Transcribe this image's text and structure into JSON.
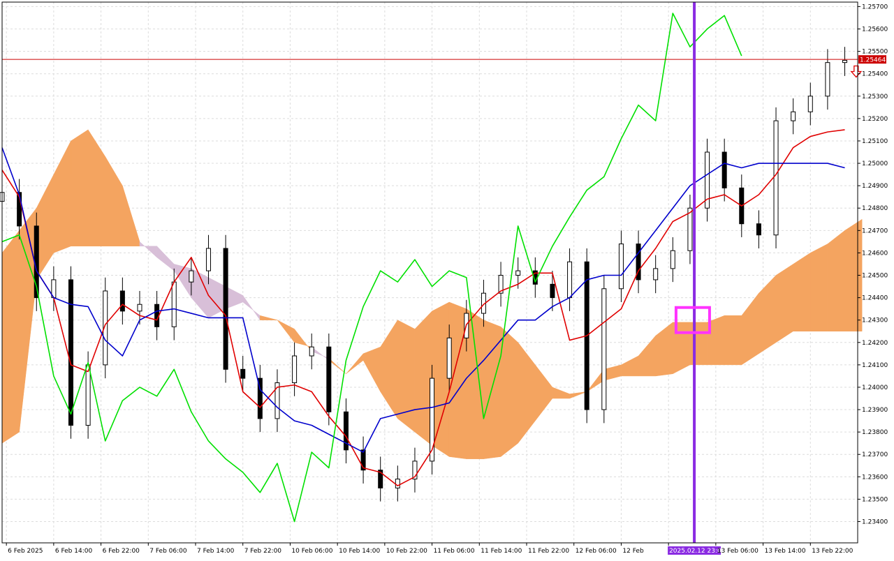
{
  "colors": {
    "background": "#ffffff",
    "grid": "#dcdcdc",
    "axis": "#000000",
    "tenkan": "#e00000",
    "kijun": "#0000cc",
    "chikou": "#00e000",
    "kumo_bull": "#f4a460",
    "kumo_bear": "#d8bfd8",
    "candle_bull": "#ffffff",
    "candle_bear": "#000000",
    "price_line": "#cc0000",
    "price_tag_bg": "#cc0000",
    "vertical_marker": "#8a2be2",
    "highlight_box": "#ff33ff",
    "arrow": "#e00000"
  },
  "header": {
    "current_price_tag": "1.25464",
    "marker_time_tag": "2025.02.12 23:00"
  },
  "chart_data": {
    "type": "line",
    "title": "",
    "xlabel": "",
    "ylabel": "",
    "ylim": [
      1.23305,
      1.2572
    ],
    "grid": true,
    "price_ticks": [
      "1.25700",
      "1.25600",
      "1.25500",
      "1.25400",
      "1.25300",
      "1.25200",
      "1.25100",
      "1.25000",
      "1.24900",
      "1.24800",
      "1.24700",
      "1.24600",
      "1.24500",
      "1.24400",
      "1.24300",
      "1.24200",
      "1.24100",
      "1.24000",
      "1.23900",
      "1.23800",
      "1.23700",
      "1.23600",
      "1.23500",
      "1.23400"
    ],
    "time_ticks": [
      "6 Feb 2025",
      "6 Feb 14:00",
      "6 Feb 22:00",
      "7 Feb 06:00",
      "7 Feb 14:00",
      "7 Feb 22:00",
      "10 Feb 06:00",
      "10 Feb 14:00",
      "10 Feb 22:00",
      "11 Feb 06:00",
      "11 Feb 14:00",
      "11 Feb 22:00",
      "12 Feb 06:00",
      "12 Feb",
      "",
      "13 Feb 06:00",
      "13 Feb 14:00",
      "13 Feb 22:00"
    ],
    "bar_index": [
      0,
      4,
      8,
      12,
      16,
      20,
      24,
      28,
      32,
      36,
      40,
      44,
      48,
      52,
      56,
      60,
      64,
      68,
      72,
      76,
      80,
      84,
      88,
      92,
      96,
      100,
      104,
      108,
      112,
      116,
      120,
      124,
      128,
      132,
      136,
      140,
      144,
      148,
      152,
      156,
      160,
      164,
      168,
      172,
      176,
      180,
      184,
      188,
      192,
      196
    ],
    "current_price": 1.25464,
    "marker_bar": 161,
    "highlight_bar": 160,
    "highlight_price": 1.243,
    "sell_arrow": {
      "bar": 198,
      "price": 1.2541
    },
    "series": [
      {
        "name": "Close",
        "values": [
          1.2487,
          1.2472,
          1.244,
          1.2448,
          1.2383,
          1.241,
          1.2443,
          1.2434,
          1.2437,
          1.2427,
          1.2447,
          1.2452,
          1.2462,
          1.2408,
          1.2404,
          1.2386,
          1.2402,
          1.2414,
          1.2418,
          1.2389,
          1.2372,
          1.2363,
          1.2355,
          1.2359,
          1.2367,
          1.2404,
          1.2422,
          1.2433,
          1.2442,
          1.245,
          1.2452,
          1.2446,
          1.244,
          1.2456,
          1.239,
          1.2444,
          1.2464,
          1.2448,
          1.2453,
          1.2461,
          1.248,
          1.2505,
          1.2489,
          1.2473,
          1.2468,
          1.2519,
          1.2523,
          1.253,
          1.2545,
          1.2546
        ]
      },
      {
        "name": "Tenkan-sen",
        "values": [
          1.2497,
          1.2485,
          1.2452,
          1.244,
          1.241,
          1.2407,
          1.2428,
          1.2437,
          1.2432,
          1.243,
          1.2447,
          1.2458,
          1.2441,
          1.2432,
          1.2398,
          1.2391,
          1.24,
          1.2401,
          1.2398,
          1.2387,
          1.2378,
          1.2364,
          1.2362,
          1.2356,
          1.236,
          1.2372,
          1.2398,
          1.2428,
          1.2437,
          1.2443,
          1.2446,
          1.2451,
          1.2451,
          1.2421,
          1.2423,
          1.2429,
          1.2435,
          1.2452,
          1.2462,
          1.2474,
          1.2478,
          1.2484,
          1.2486,
          1.2481,
          1.2486,
          1.2495,
          1.2507,
          1.2512,
          1.2514,
          1.2515
        ]
      },
      {
        "name": "Kijun-sen",
        "values": [
          1.2507,
          1.2486,
          1.2452,
          1.244,
          1.2437,
          1.2436,
          1.2421,
          1.2414,
          1.243,
          1.2434,
          1.2435,
          1.2433,
          1.2431,
          1.2431,
          1.2431,
          1.2399,
          1.2391,
          1.2385,
          1.2383,
          1.2379,
          1.2375,
          1.2371,
          1.2386,
          1.2388,
          1.239,
          1.2391,
          1.2393,
          1.2404,
          1.2412,
          1.2421,
          1.243,
          1.243,
          1.2436,
          1.244,
          1.2448,
          1.245,
          1.245,
          1.246,
          1.247,
          1.248,
          1.249,
          1.2495,
          1.25,
          1.2498,
          1.25,
          1.25,
          1.25,
          1.25,
          1.25,
          1.2498
        ]
      },
      {
        "name": "Chikou Span",
        "values": [
          1.2465,
          1.2468,
          1.2445,
          1.2405,
          1.2388,
          1.2411,
          1.2376,
          1.2394,
          1.24,
          1.2396,
          1.2408,
          1.2389,
          1.2376,
          1.2368,
          1.2362,
          1.2353,
          1.2366,
          1.234,
          1.2371,
          1.2364,
          1.2412,
          1.2436,
          1.2452,
          1.2447,
          1.2457,
          1.2445,
          1.2452,
          1.2449,
          1.2386,
          1.2414,
          1.2472,
          1.2447,
          1.2463,
          1.2476,
          1.2488,
          1.2494,
          1.2511,
          1.2526,
          1.2519,
          1.2567,
          1.2552,
          1.256,
          1.2566,
          1.2548
        ]
      },
      {
        "name": "Senkou Span A",
        "values": [
          1.246,
          1.247,
          1.248,
          1.2495,
          1.251,
          1.2515,
          1.2503,
          1.249,
          1.2465,
          1.2458,
          1.2452,
          1.244,
          1.2431,
          1.2435,
          1.2438,
          1.2432,
          1.243,
          1.2426,
          1.2416,
          1.2413,
          1.2406,
          1.2415,
          1.2418,
          1.243,
          1.2426,
          1.2434,
          1.2438,
          1.2435,
          1.243,
          1.2427,
          1.242,
          1.241,
          1.24,
          1.2397,
          1.2398,
          1.2408,
          1.241,
          1.2414,
          1.2423,
          1.2429,
          1.2429,
          1.2429,
          1.2432,
          1.2432,
          1.2442,
          1.245,
          1.2455,
          1.246,
          1.2464,
          1.247,
          1.2475
        ]
      },
      {
        "name": "Senkou Span B",
        "values": [
          1.2375,
          1.238,
          1.2448,
          1.246,
          1.2463,
          1.2463,
          1.2463,
          1.2463,
          1.2463,
          1.2463,
          1.2455,
          1.2453,
          1.2449,
          1.2445,
          1.2441,
          1.243,
          1.243,
          1.242,
          1.2418,
          1.2412,
          1.2406,
          1.2412,
          1.2398,
          1.2386,
          1.238,
          1.2374,
          1.2369,
          1.2368,
          1.2368,
          1.2369,
          1.2375,
          1.2385,
          1.2395,
          1.2395,
          1.2398,
          1.2403,
          1.2405,
          1.2405,
          1.2405,
          1.2406,
          1.241,
          1.241,
          1.241,
          1.241,
          1.2415,
          1.242,
          1.2425,
          1.2425,
          1.2425,
          1.2425,
          1.2425
        ]
      }
    ]
  }
}
